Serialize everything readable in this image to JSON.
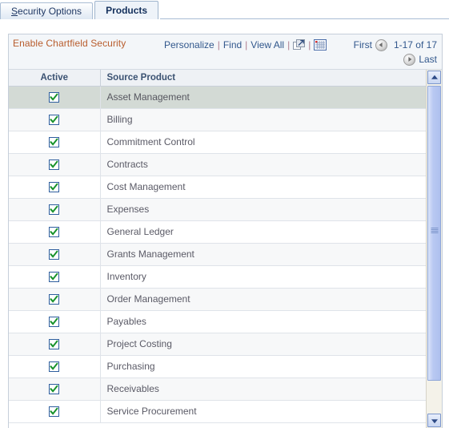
{
  "tabs": [
    {
      "label": "Security Options",
      "accel": "S",
      "rest": "ecurity Options",
      "active": false
    },
    {
      "label": "Products",
      "active": true
    }
  ],
  "grid": {
    "title": "Enable Chartfield Security",
    "actions": {
      "personalize": "Personalize",
      "find": "Find",
      "view_all": "View All",
      "separator": "|",
      "new_window_icon": "new-window-icon",
      "download_grid_icon": "download-spreadsheet-icon"
    },
    "pager": {
      "first": "First",
      "range": "1-17 of 17",
      "last": "Last",
      "prev_icon": "arrow-left-icon",
      "next_icon": "arrow-right-icon"
    },
    "columns": [
      "Active",
      "Source Product"
    ],
    "rows": [
      {
        "active": true,
        "product": "Asset Management"
      },
      {
        "active": true,
        "product": "Billing"
      },
      {
        "active": true,
        "product": "Commitment Control"
      },
      {
        "active": true,
        "product": "Contracts"
      },
      {
        "active": true,
        "product": "Cost Management"
      },
      {
        "active": true,
        "product": "Expenses"
      },
      {
        "active": true,
        "product": "General Ledger"
      },
      {
        "active": true,
        "product": "Grants Management"
      },
      {
        "active": true,
        "product": "Inventory"
      },
      {
        "active": true,
        "product": "Order Management"
      },
      {
        "active": true,
        "product": "Payables"
      },
      {
        "active": true,
        "product": "Project Costing"
      },
      {
        "active": true,
        "product": "Purchasing"
      },
      {
        "active": true,
        "product": "Receivables"
      },
      {
        "active": true,
        "product": "Service Procurement"
      }
    ]
  },
  "colors": {
    "title": "#b85c2c",
    "link": "#31578c",
    "header_text": "#3b5272",
    "selected_row": "#d3dad5",
    "checkbox_border": "#2f5f9e",
    "check_green": "#18922b"
  }
}
